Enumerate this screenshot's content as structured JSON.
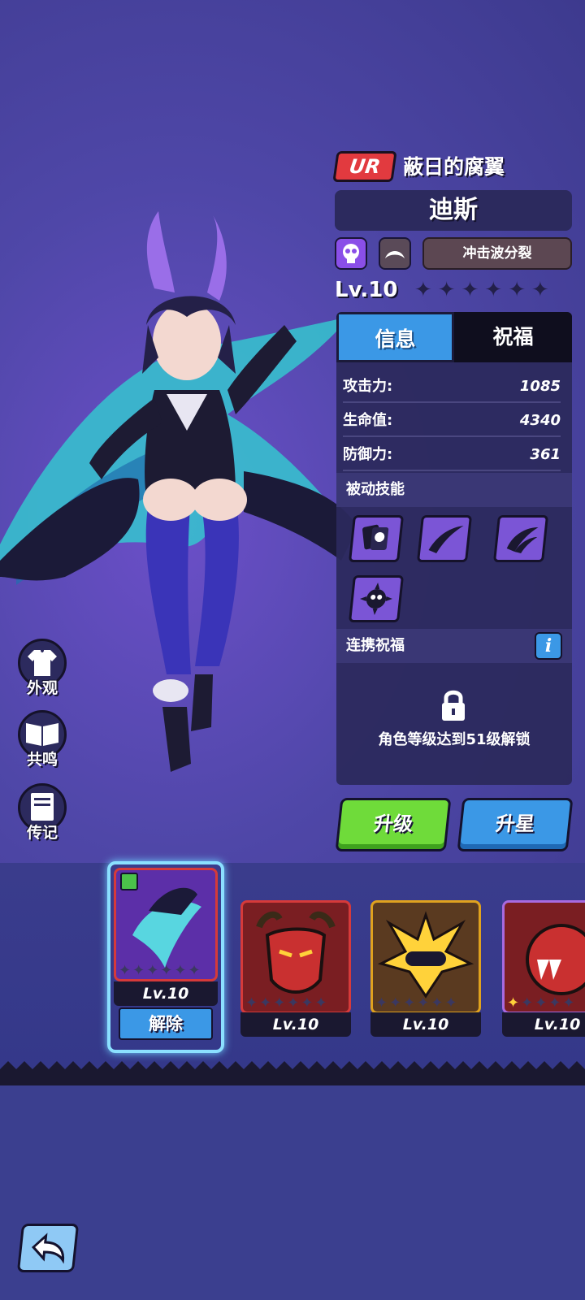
{
  "weapon": {
    "rarity": "UR",
    "title": "蔽日的腐翼",
    "character_name": "迪斯",
    "skill_tag": "冲击波分裂",
    "level": "Lv.10",
    "stars_filled": 0,
    "stars_total": 6
  },
  "panel": {
    "tabs": [
      {
        "label": "信息",
        "active": true
      },
      {
        "label": "祝福",
        "active": false
      }
    ],
    "stats": [
      {
        "label": "攻击力:",
        "value": "1085"
      },
      {
        "label": "生命值:",
        "value": "4340"
      },
      {
        "label": "防御力:",
        "value": "361"
      }
    ],
    "passive_skills_title": "被动技能",
    "passive_skill_icons": [
      "cards-skull-icon",
      "claw-slash-icon",
      "wing-slash-icon",
      "spiked-bomb-icon"
    ],
    "link_blessing_title": "连携祝福",
    "info_button": "i",
    "unlock_text": "角色等级达到51级解锁"
  },
  "actions": {
    "upgrade": "升级",
    "star_up": "升星"
  },
  "side_menu": [
    {
      "label": "外观",
      "icon": "shirt-icon"
    },
    {
      "label": "共鸣",
      "icon": "book-icon"
    },
    {
      "label": "传记",
      "icon": "journal-icon"
    }
  ],
  "weapon_cards": [
    {
      "level": "Lv.10",
      "color": "#6b3fb8",
      "border": "#2a1850",
      "selected": true,
      "equipped": true,
      "action": "解除"
    },
    {
      "level": "Lv.10",
      "color": "#7a1e22",
      "border": "#d63a3a",
      "selected": false
    },
    {
      "level": "Lv.10",
      "color": "#5a3a20",
      "border": "#e0a21e",
      "selected": false
    },
    {
      "level": "Lv.10",
      "color": "#7a1e22",
      "border": "#a86ae0",
      "selected": false
    }
  ],
  "colors": {
    "accent_blue": "#3b98e6",
    "accent_green": "#6fdb3a",
    "rarity_red": "#e23a3f"
  }
}
